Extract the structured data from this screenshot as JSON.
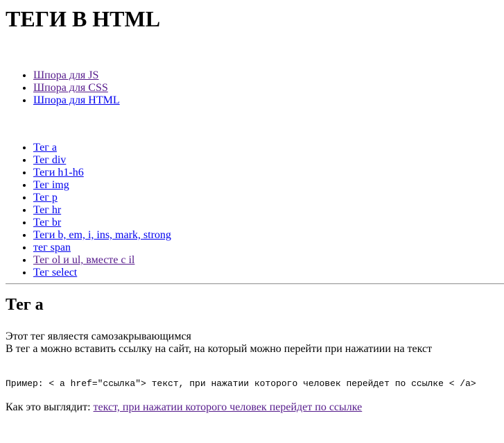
{
  "page": {
    "title": "ТЕГИ В HTML"
  },
  "cheatsheets": [
    {
      "label": "Шпора для JS",
      "visited": true
    },
    {
      "label": "Шпора для CSS",
      "visited": true
    },
    {
      "label": "Шпора для HTML",
      "visited": false
    }
  ],
  "tags": [
    {
      "label": "Тег a",
      "visited": false
    },
    {
      "label": "Тег div",
      "visited": false
    },
    {
      "label": "Теги h1-h6",
      "visited": false
    },
    {
      "label": "Тег img",
      "visited": false
    },
    {
      "label": "Тег p",
      "visited": false
    },
    {
      "label": "Тег hr",
      "visited": false
    },
    {
      "label": "Тег br",
      "visited": false
    },
    {
      "label": "Теги b, em, i, ins, mark, strong",
      "visited": false
    },
    {
      "label": "тег span",
      "visited": false
    },
    {
      "label": "Тег ol и ul, вместе с il",
      "visited": true
    },
    {
      "label": "Тег select",
      "visited": false
    }
  ],
  "section": {
    "title": "Тег a",
    "desc_line1": "Этот тег являестя самозакрывающимся",
    "desc_line2": "В тег а можно вставить ссылку на сайт, на который можно перейти при нажатиии на текст",
    "example": "Пример: < a href=\"ссылка\"> текст, при нажатии которого человек перейдет по ссылке < /a>",
    "result_prefix": "Как это выглядит: ",
    "result_link": "текст, при нажатии которого человек перейдет по ссылке"
  },
  "colors": {
    "link": "#0000ee",
    "link_visited": "#551a8b",
    "text": "#000000",
    "background": "#ffffff"
  }
}
